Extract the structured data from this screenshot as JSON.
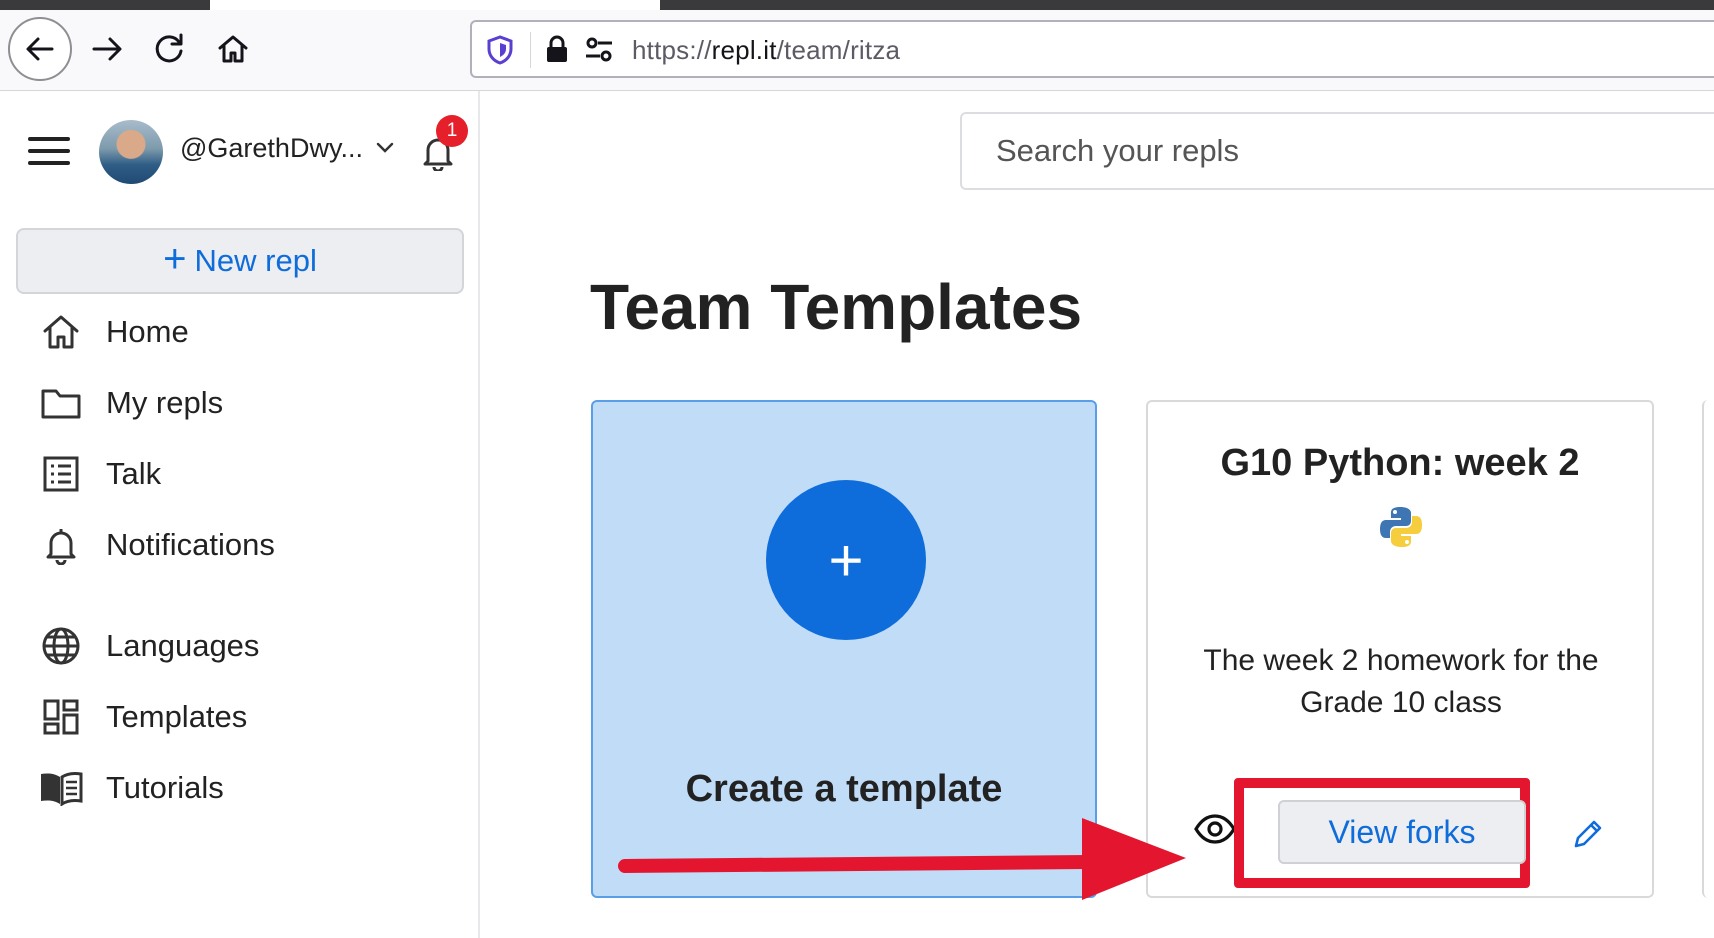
{
  "browser": {
    "url_prefix": "https://",
    "url_host": "repl.it",
    "url_path": "/team/ritza"
  },
  "sidebar": {
    "username": "@GarethDwy...",
    "notification_count": "1",
    "new_repl_label": "New repl",
    "nav_items": [
      {
        "label": "Home",
        "icon": "home-icon"
      },
      {
        "label": "My repls",
        "icon": "folder-icon"
      },
      {
        "label": "Talk",
        "icon": "talk-icon"
      },
      {
        "label": "Notifications",
        "icon": "bell-icon"
      },
      {
        "label": "Languages",
        "icon": "globe-icon"
      },
      {
        "label": "Templates",
        "icon": "templates-icon"
      },
      {
        "label": "Tutorials",
        "icon": "book-icon"
      }
    ]
  },
  "main": {
    "search_placeholder": "Search your repls",
    "page_title": "Team Templates",
    "create_card": {
      "label": "Create a template",
      "plus": "+"
    },
    "template_card": {
      "title": "G10 Python: week 2",
      "description": "The week 2 homework for the Grade 10 class",
      "view_forks_label": "View forks"
    }
  },
  "annotation": {
    "highlight_color": "#e4162f",
    "arrow_color": "#e4162f"
  },
  "colors": {
    "accent": "#0f6cdb",
    "create_card_bg": "#c0dcf7"
  }
}
